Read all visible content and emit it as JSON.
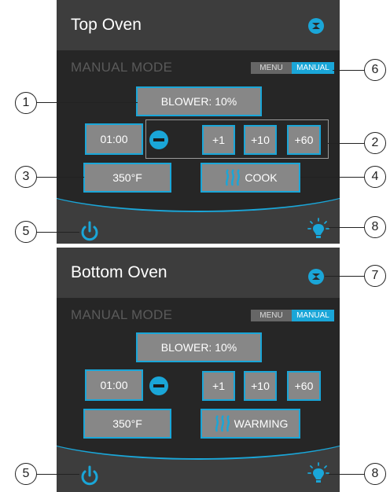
{
  "top_oven": {
    "title": "Top Oven",
    "mode_label": "MANUAL MODE",
    "toggle_menu": "MENU",
    "toggle_manual": "MANUAL",
    "blower": "BLOWER: 10%",
    "timer": "01:00",
    "plus1": "+1",
    "plus10": "+10",
    "plus60": "+60",
    "temp": "350°F",
    "action": "COOK"
  },
  "bottom_oven": {
    "title": "Bottom Oven",
    "mode_label": "MANUAL MODE",
    "toggle_menu": "MENU",
    "toggle_manual": "MANUAL",
    "blower": "BLOWER: 10%",
    "timer": "01:00",
    "plus1": "+1",
    "plus10": "+10",
    "plus60": "+60",
    "temp": "350°F",
    "action": "WARMING"
  },
  "callouts": [
    "1",
    "2",
    "3",
    "4",
    "5",
    "6",
    "7",
    "8"
  ],
  "colors": {
    "accent": "#1aa6d8",
    "header_bg": "#3d3d3d",
    "body_bg": "#262626",
    "button_bg": "#878787"
  },
  "icons": [
    "collapse-icon",
    "minus-icon",
    "heat-waves-icon",
    "power-icon",
    "light-bulb-icon"
  ]
}
